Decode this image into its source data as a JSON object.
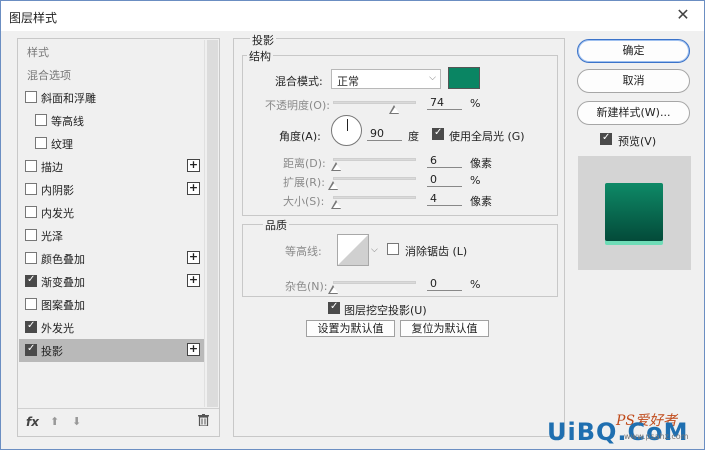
{
  "window": {
    "title": "图层样式",
    "close_glyph": "✕"
  },
  "styles_panel": {
    "rows": [
      {
        "label": "样式",
        "header": true
      },
      {
        "label": "混合选项",
        "header": true
      },
      {
        "label": "斜面和浮雕",
        "checkbox": true,
        "checked": false
      },
      {
        "label": "等高线",
        "checkbox": true,
        "checked": false,
        "indent": true
      },
      {
        "label": "纹理",
        "checkbox": true,
        "checked": false,
        "indent": true
      },
      {
        "label": "描边",
        "checkbox": true,
        "checked": false,
        "plus": true
      },
      {
        "label": "内阴影",
        "checkbox": true,
        "checked": false,
        "plus": true
      },
      {
        "label": "内发光",
        "checkbox": true,
        "checked": false
      },
      {
        "label": "光泽",
        "checkbox": true,
        "checked": false
      },
      {
        "label": "颜色叠加",
        "checkbox": true,
        "checked": false,
        "plus": true
      },
      {
        "label": "渐变叠加",
        "checkbox": true,
        "checked": true,
        "plus": true
      },
      {
        "label": "图案叠加",
        "checkbox": true,
        "checked": false
      },
      {
        "label": "外发光",
        "checkbox": true,
        "checked": true
      },
      {
        "label": "投影",
        "checkbox": true,
        "checked": true,
        "plus": true,
        "selected": true
      }
    ],
    "footer": {
      "fx_label": "fx",
      "up_icon": "arrow-up-icon",
      "down_icon": "arrow-down-icon",
      "trash_icon": "trash-icon"
    }
  },
  "drop_shadow": {
    "section_title": "投影",
    "structure": {
      "title": "结构",
      "blend_mode_label": "混合模式:",
      "blend_mode_value": "正常",
      "shadow_color": "#0a8563",
      "opacity_label": "不透明度(O):",
      "opacity_value": "74",
      "opacity_unit": "%",
      "opacity_level": 0.74,
      "angle_label": "角度(A):",
      "angle_value": "90",
      "angle_unit": "度",
      "global_light_label": "使用全局光 (G)",
      "global_light_checked": true,
      "distance_label": "距离(D):",
      "distance_value": "6",
      "distance_unit": "像素",
      "spread_label": "扩展(R):",
      "spread_value": "0",
      "spread_unit": "%",
      "size_label": "大小(S):",
      "size_value": "4",
      "size_unit": "像素"
    },
    "quality": {
      "title": "品质",
      "contour_label": "等高线:",
      "antialias_label": "消除锯齿 (L)",
      "antialias_checked": false,
      "noise_label": "杂色(N):",
      "noise_value": "0",
      "noise_unit": "%"
    },
    "knockout_label": "图层挖空投影(U)",
    "knockout_checked": true,
    "make_default_label": "设置为默认值",
    "reset_default_label": "复位为默认值"
  },
  "right_panel": {
    "ok_label": "确定",
    "cancel_label": "取消",
    "new_style_label": "新建样式(W)...",
    "preview_label": "预览(V)",
    "preview_checked": true
  },
  "watermark": {
    "main": "UiBQ.CoM",
    "small": "PS爱好者",
    "url": "www.psahz.com"
  }
}
